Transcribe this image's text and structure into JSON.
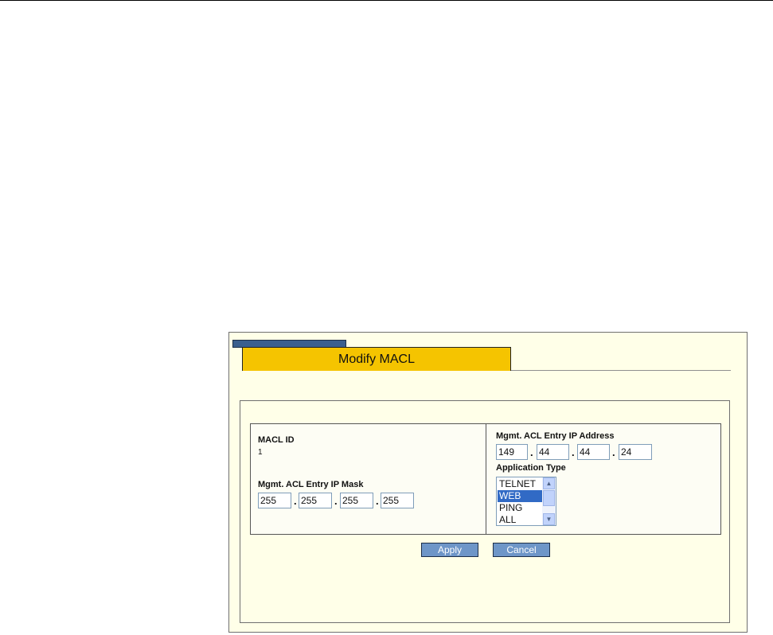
{
  "panel": {
    "title": "Modify MACL"
  },
  "left": {
    "macl_id_label": "MACL ID",
    "macl_id_value": "1",
    "mask_label": "Mgmt. ACL Entry IP Mask",
    "mask_octets": [
      "255",
      "255",
      "255",
      "255"
    ]
  },
  "right": {
    "ip_label": "Mgmt. ACL Entry IP Address",
    "ip_octets": [
      "149",
      "44",
      "44",
      "24"
    ],
    "app_type_label": "Application Type",
    "app_options": [
      "TELNET",
      "WEB",
      "PING",
      "ALL"
    ],
    "app_selected": "WEB"
  },
  "buttons": {
    "apply": "Apply",
    "cancel": "Cancel"
  },
  "colors": {
    "tab_yellow": "#f5c400",
    "panel_bg": "#ffffe8",
    "button_blue": "#6e96c8",
    "tab_strip_blue": "#3b5f8e",
    "selection_blue": "#316ac5"
  }
}
